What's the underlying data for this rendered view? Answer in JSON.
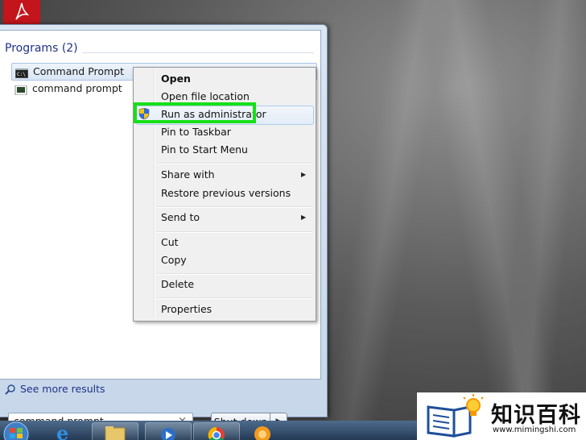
{
  "start_menu": {
    "group_header": "Programs (2)",
    "programs": [
      {
        "label": "Command Prompt",
        "icon": "cmd-icon"
      },
      {
        "label": "command prompt",
        "icon": "cmd-file-icon"
      }
    ],
    "see_more": "See more results",
    "search_value": "command prompt",
    "search_clear": "×",
    "shutdown_label": "Shut down",
    "shutdown_arrow": "▶"
  },
  "context_menu": {
    "items": [
      {
        "label": "Open",
        "bold": true
      },
      {
        "label": "Open file location"
      },
      {
        "label": "Run as administrator",
        "icon": "uac-shield-icon",
        "highlighted": true
      },
      {
        "label": "Pin to Taskbar"
      },
      {
        "label": "Pin to Start Menu"
      },
      {
        "label": "Share with",
        "submenu": true
      },
      {
        "label": "Restore previous versions"
      },
      {
        "label": "Send to",
        "submenu": true
      },
      {
        "label": "Cut"
      },
      {
        "label": "Copy"
      },
      {
        "label": "Delete"
      },
      {
        "label": "Properties"
      }
    ],
    "submenu_arrow": "▶",
    "highlight_color": "#16e016"
  },
  "taskbar": {
    "items": [
      "start-orb-icon",
      "internet-explorer-icon",
      "explorer-icon",
      "media-player-icon",
      "chrome-icon",
      "vlc-icon"
    ]
  },
  "watermark": {
    "text": "知识百科",
    "url": "www.mimingshi.com"
  },
  "colors": {
    "pdf_red": "#c3151b",
    "menu_blue_text": "#1e3287"
  }
}
